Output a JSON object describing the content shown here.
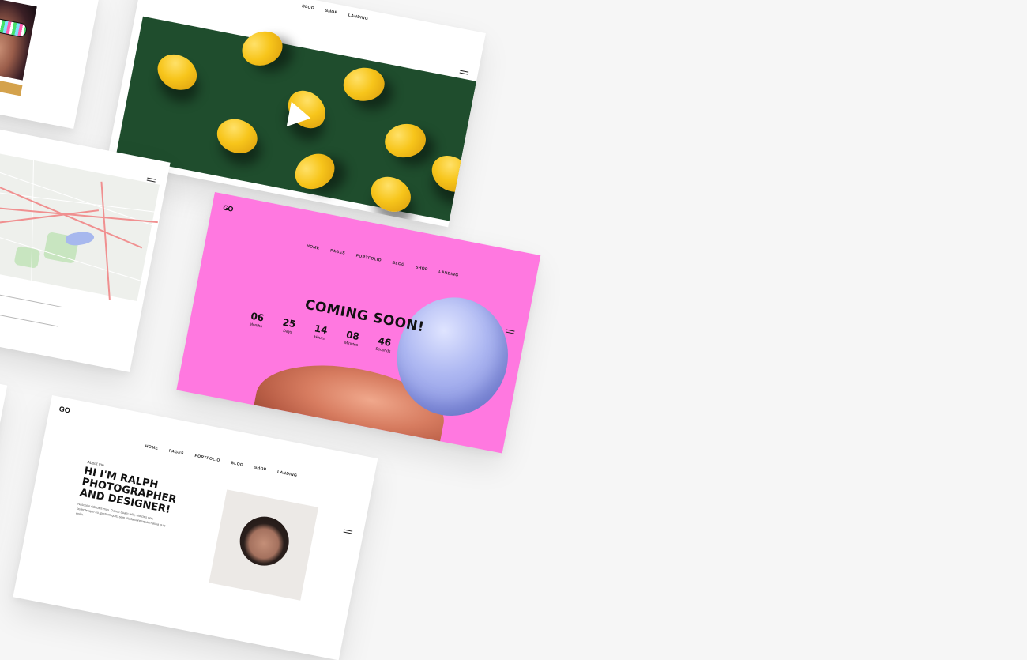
{
  "nav": [
    "HOME",
    "PAGES",
    "PORTFOLIO",
    "BLOG",
    "SHOP",
    "LANDING"
  ],
  "lemon_card": {
    "nav_visible": [
      "BLOG",
      "SHOP",
      "LANDING"
    ]
  },
  "coming_soon": {
    "logo": "GO",
    "headline": "COMING SOON!",
    "countdown": [
      {
        "value": "06",
        "unit": "Months"
      },
      {
        "value": "25",
        "unit": "Days"
      },
      {
        "value": "14",
        "unit": "Hours"
      },
      {
        "value": "08",
        "unit": "Minutes"
      },
      {
        "value": "46",
        "unit": "Seconds"
      }
    ]
  },
  "about": {
    "logo": "GO",
    "label": "About me",
    "headline_lines": [
      "HI I'M RALPH",
      "PHOTOGRAPHER",
      "AND DESIGNER!"
    ],
    "body": "Nascetur ridiculus mus. Donec quam felis, ultricies nec, pellentesque eu, pretium quis, sem. Nulla consequat massa quis enim."
  },
  "colors": {
    "background": "#f6f6f6",
    "pink": "#ff78e0",
    "lemon_bg": "#1f4d2d",
    "balloon": "#aeb8f2"
  },
  "icons": [
    "hamburger-menu-icon",
    "play-icon",
    "map-pin-icon",
    "logo-icon"
  ]
}
